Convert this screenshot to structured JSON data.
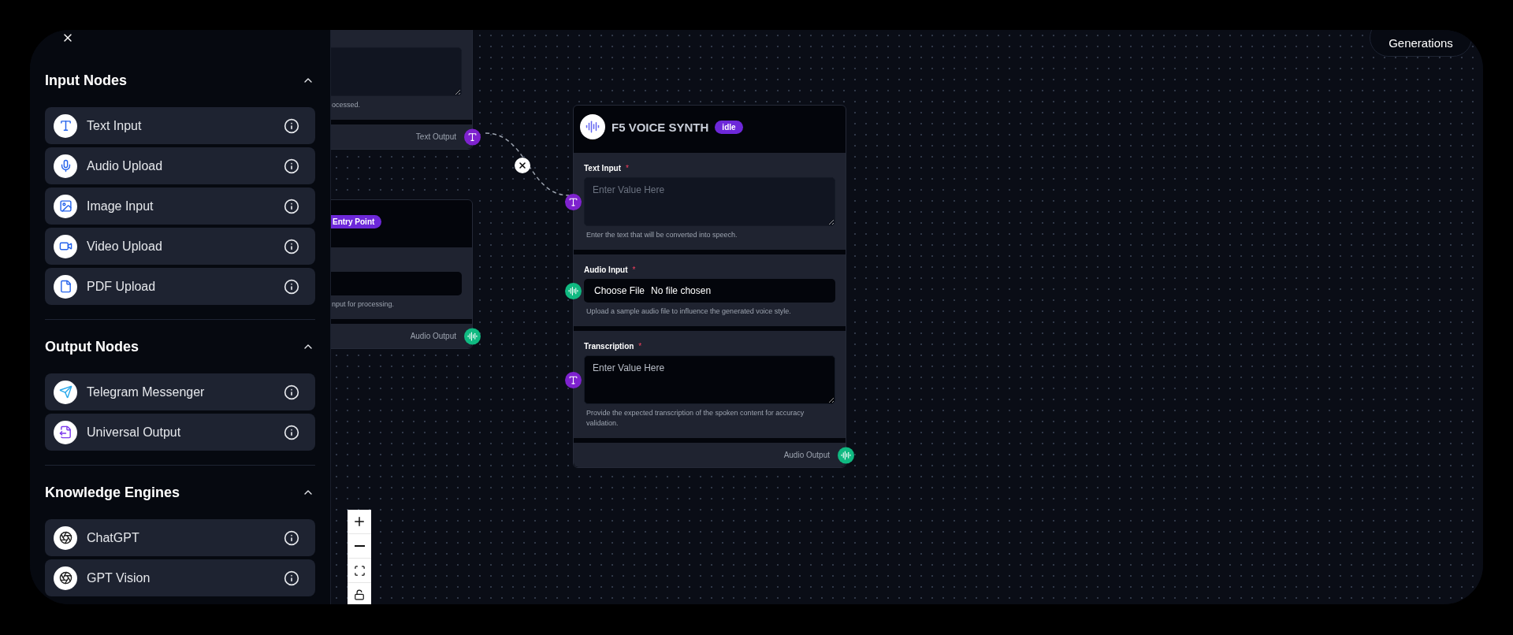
{
  "sidebar": {
    "sections": [
      {
        "title": "Input Nodes",
        "expanded": true,
        "items": [
          {
            "label": "Text Input",
            "kind": "text"
          },
          {
            "label": "Audio Upload",
            "kind": "audio"
          },
          {
            "label": "Image Input",
            "kind": "image"
          },
          {
            "label": "Video Upload",
            "kind": "video"
          },
          {
            "label": "PDF Upload",
            "kind": "pdf"
          }
        ]
      },
      {
        "title": "Output Nodes",
        "expanded": true,
        "items": [
          {
            "label": "Telegram Messenger",
            "kind": "telegram"
          },
          {
            "label": "Universal Output",
            "kind": "output"
          }
        ]
      },
      {
        "title": "Knowledge Engines",
        "expanded": true,
        "items": [
          {
            "label": "ChatGPT",
            "kind": "chatgpt"
          },
          {
            "label": "GPT Vision",
            "kind": "chatgpt"
          }
        ]
      }
    ]
  },
  "generations_button": "Generations",
  "canvas": {
    "nodes": [
      {
        "fields": [
          {
            "kind": "textarea",
            "helper": "ocessed."
          }
        ],
        "output": {
          "label": "Text Output",
          "kind": "text"
        }
      },
      {
        "badge": "Entry Point",
        "fields": [
          {
            "kind": "input",
            "helper": "nput for processing."
          }
        ],
        "output": {
          "label": "Audio Output",
          "kind": "audio"
        }
      },
      {
        "title": "F5 VOICE SYNTH",
        "badge": "idle",
        "fields": [
          {
            "kind": "textarea",
            "label": "Text Input",
            "marker": "*",
            "placeholder": "Enter Value Here",
            "helper": "Enter the text that will be converted into speech.",
            "handle": {
              "kind": "text"
            }
          },
          {
            "kind": "file",
            "label": "Audio Input",
            "marker": "*",
            "button": "Choose File",
            "value": "No file chosen",
            "helper": "Upload a sample audio file to influence the generated voice style.",
            "handle": {
              "kind": "audio"
            }
          },
          {
            "kind": "textarea",
            "label": "Transcription",
            "marker": "*",
            "placeholder": "Enter Value Here",
            "helper": "Provide the expected transcription of the spoken content for accuracy validation.",
            "handle": {
              "kind": "text"
            }
          }
        ],
        "output": {
          "label": "Audio Output",
          "kind": "audio"
        }
      }
    ]
  }
}
